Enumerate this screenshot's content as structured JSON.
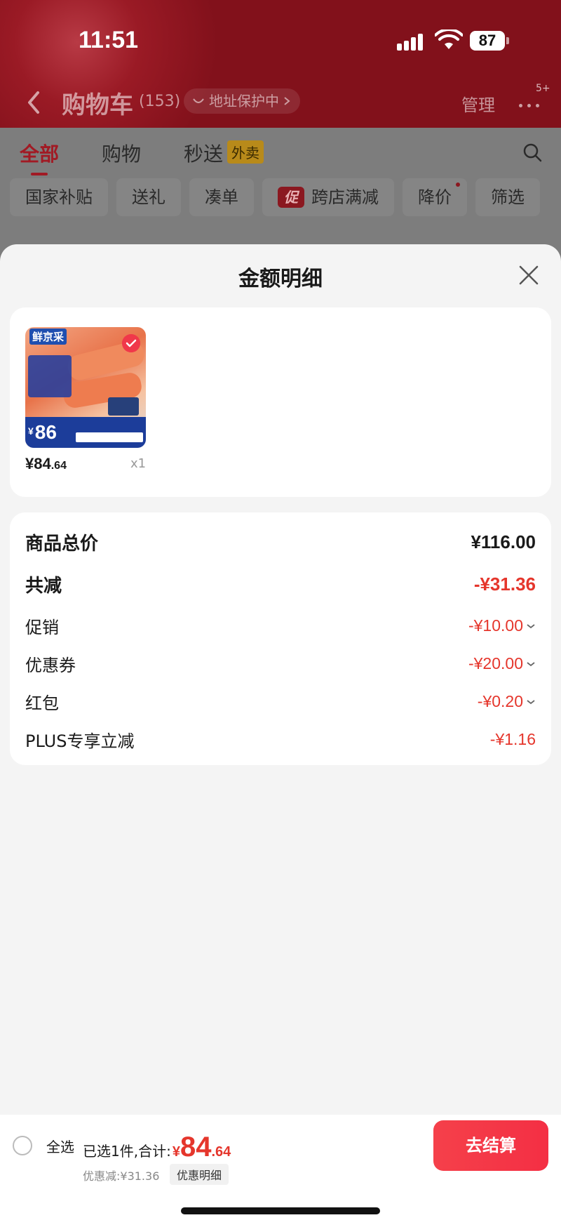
{
  "status_bar": {
    "time": "11:51",
    "battery": "87"
  },
  "nav": {
    "title": "购物车",
    "count": "(153)",
    "address_protect": "地址保护中",
    "manage": "管理",
    "more_badge": "5+"
  },
  "tabs": [
    {
      "label": "全部"
    },
    {
      "label": "购物"
    },
    {
      "label": "秒送",
      "tag": "外卖"
    }
  ],
  "chips": [
    "国家补贴",
    "送礼",
    "凑单",
    "跨店满减",
    "降价",
    "筛选"
  ],
  "chips_promo_mark": "促",
  "sheet": {
    "title": "金额明细",
    "product": {
      "brand": "鲜京采",
      "badge_price": "86",
      "badge_currency": "¥",
      "price_int": "¥84",
      "price_dec": ".64",
      "qty": "x1"
    },
    "summary": [
      {
        "label": "商品总价",
        "value": "¥116.00"
      },
      {
        "label": "共减",
        "value": "-¥31.36"
      },
      {
        "label": "促销",
        "value": "-¥10.00"
      },
      {
        "label": "优惠券",
        "value": "-¥20.00"
      },
      {
        "label": "红包",
        "value": "-¥0.20"
      },
      {
        "label": "PLUS专享立减",
        "value": "-¥1.16"
      }
    ]
  },
  "bottom_bar": {
    "select_all": "全选",
    "selected_prefix": "已选1件,合计:",
    "total_currency": "¥",
    "total_int": "84",
    "total_dec": ".64",
    "discount": "优惠减:¥31.36",
    "detail": "优惠明细",
    "checkout": "去结算"
  },
  "colors": {
    "accent": "#e5362c",
    "checkout": "#f42f44",
    "sheet_bg": "#f4f4f4"
  }
}
